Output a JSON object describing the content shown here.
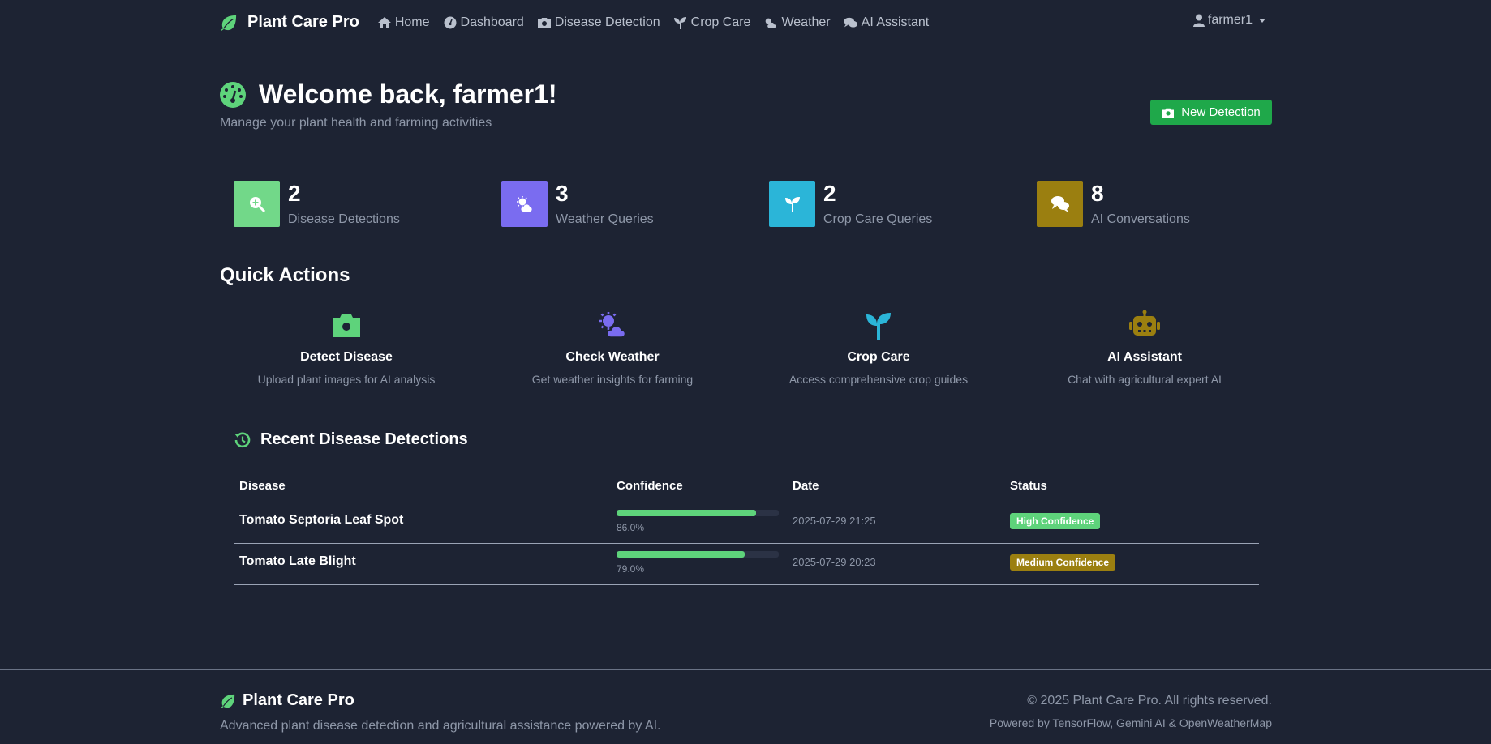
{
  "colors": {
    "background": "#1d2333",
    "accent_green": "#1fa84a",
    "leaf_green": "#5ed37b",
    "purple": "#7a6cf0",
    "cyan": "#2bb5d8",
    "olive": "#9b7f10"
  },
  "navbar": {
    "brand": "Plant Care Pro",
    "brand_icon": "leaf-icon",
    "links": [
      {
        "label": "Home",
        "icon": "home-icon"
      },
      {
        "label": "Dashboard",
        "icon": "dashboard-icon"
      },
      {
        "label": "Disease Detection",
        "icon": "camera-icon"
      },
      {
        "label": "Crop Care",
        "icon": "seedling-icon"
      },
      {
        "label": "Weather",
        "icon": "cloud-sun-icon"
      },
      {
        "label": "AI Assistant",
        "icon": "comments-icon"
      }
    ],
    "user": "farmer1"
  },
  "header": {
    "title": "Welcome back, farmer1!",
    "subtitle": "Manage your plant health and farming activities",
    "new_detection_label": "New Detection"
  },
  "stats": [
    {
      "value": "2",
      "label": "Disease Detections",
      "icon": "search-plus-icon",
      "color": "#72d889"
    },
    {
      "value": "3",
      "label": "Weather Queries",
      "icon": "cloud-sun-icon",
      "color": "#7a6cf0"
    },
    {
      "value": "2",
      "label": "Crop Care Queries",
      "icon": "seedling-icon",
      "color": "#2bb5d8"
    },
    {
      "value": "8",
      "label": "AI Conversations",
      "icon": "comments-icon",
      "color": "#9b7f10"
    }
  ],
  "quick_actions": {
    "heading": "Quick Actions",
    "items": [
      {
        "title": "Detect Disease",
        "desc": "Upload plant images for AI analysis",
        "icon": "camera-icon"
      },
      {
        "title": "Check Weather",
        "desc": "Get weather insights for farming",
        "icon": "cloud-sun-icon"
      },
      {
        "title": "Crop Care",
        "desc": "Access comprehensive crop guides",
        "icon": "seedling-icon"
      },
      {
        "title": "AI Assistant",
        "desc": "Chat with agricultural expert AI",
        "icon": "robot-icon"
      }
    ]
  },
  "recent": {
    "heading": "Recent Disease Detections",
    "columns": [
      "Disease",
      "Confidence",
      "Date",
      "Status"
    ],
    "rows": [
      {
        "disease": "Tomato Septoria Leaf Spot",
        "confidence": 86.0,
        "confidence_label": "86.0%",
        "date": "2025-07-29 21:25",
        "status": "High Confidence",
        "status_color": "#5ed37b"
      },
      {
        "disease": "Tomato Late Blight",
        "confidence": 79.0,
        "confidence_label": "79.0%",
        "date": "2025-07-29 20:23",
        "status": "Medium Confidence",
        "status_color": "#9b7f10"
      }
    ]
  },
  "footer": {
    "brand": "Plant Care Pro",
    "desc": "Advanced plant disease detection and agricultural assistance powered by AI.",
    "copyright": "© 2025 Plant Care Pro. All rights reserved.",
    "powered": "Powered by TensorFlow, Gemini AI & OpenWeatherMap"
  }
}
